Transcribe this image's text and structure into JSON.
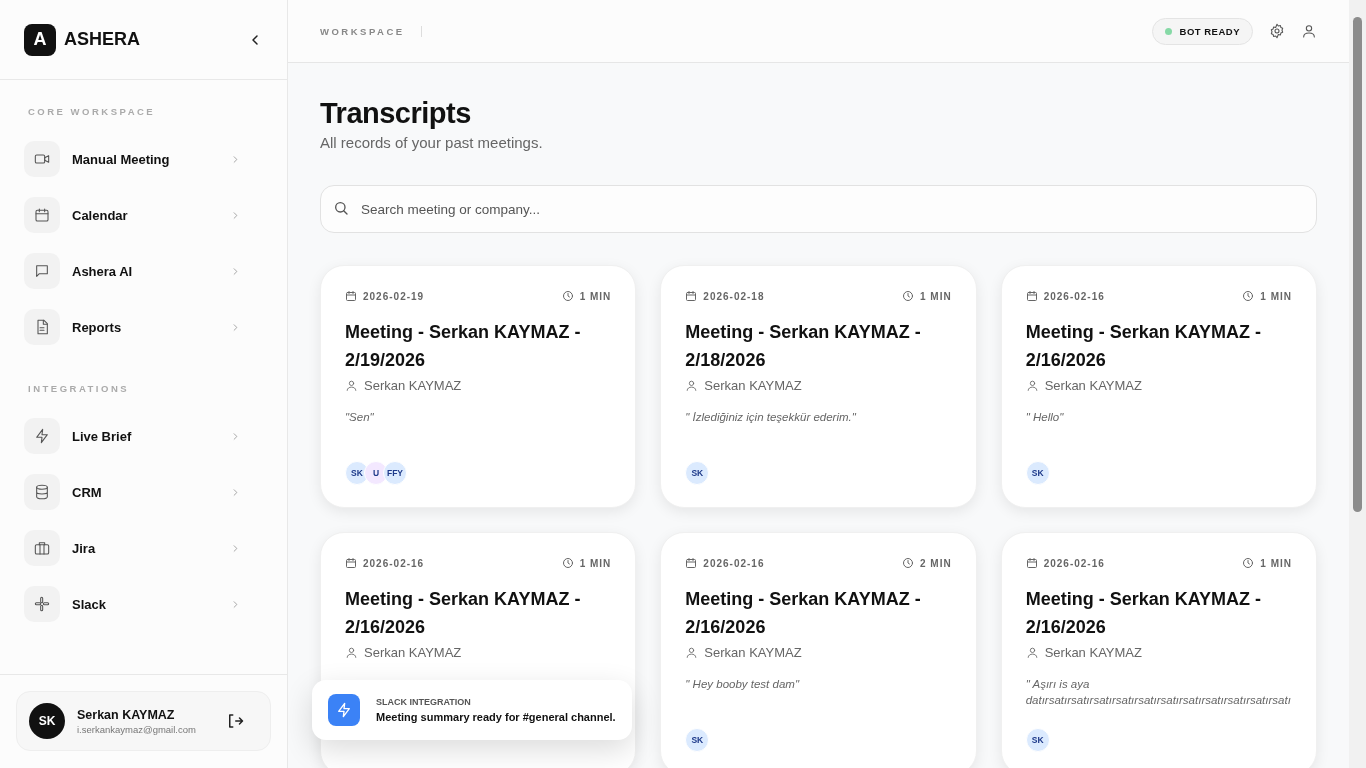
{
  "brand": {
    "logo_letter": "A",
    "name": "ASHERA"
  },
  "sidebar": {
    "sections": [
      {
        "heading": "CORE WORKSPACE",
        "items": [
          {
            "label": "Manual Meeting"
          },
          {
            "label": "Calendar"
          },
          {
            "label": "Ashera AI"
          },
          {
            "label": "Reports"
          }
        ]
      },
      {
        "heading": "INTEGRATIONS",
        "items": [
          {
            "label": "Live Brief"
          },
          {
            "label": "CRM"
          },
          {
            "label": "Jira"
          },
          {
            "label": "Slack"
          }
        ]
      }
    ],
    "user": {
      "initials": "SK",
      "name": "Serkan KAYMAZ",
      "email": "i.serkankaymaz@gmail.com"
    }
  },
  "header": {
    "breadcrumb": "WORKSPACE",
    "status": {
      "label": "BOT READY",
      "color": "#86d9a6"
    }
  },
  "page": {
    "title": "Transcripts",
    "subtitle": "All records of your past meetings.",
    "search": {
      "placeholder": "Search meeting or company..."
    }
  },
  "cards": [
    {
      "date": "2026-02-19",
      "duration": "1 MIN",
      "title": "Meeting - Serkan KAYMAZ - 2/19/2026",
      "owner": "Serkan KAYMAZ",
      "snippet": "\"Sen\"",
      "participants": [
        {
          "initials": "SK",
          "color": "#dbeafe"
        },
        {
          "initials": "U",
          "color": "#f3e8ff"
        },
        {
          "initials": "FFY",
          "color": "#dbeafe"
        }
      ]
    },
    {
      "date": "2026-02-18",
      "duration": "1 MIN",
      "title": "Meeting - Serkan KAYMAZ - 2/18/2026",
      "owner": "Serkan KAYMAZ",
      "snippet": "\" İzlediğiniz için teşekkür ederim.\"",
      "participants": [
        {
          "initials": "SK",
          "color": "#dbeafe"
        }
      ]
    },
    {
      "date": "2026-02-16",
      "duration": "1 MIN",
      "title": "Meeting - Serkan KAYMAZ - 2/16/2026",
      "owner": "Serkan KAYMAZ",
      "snippet": "\" Hello\"",
      "participants": [
        {
          "initials": "SK",
          "color": "#dbeafe"
        }
      ]
    },
    {
      "date": "2026-02-16",
      "duration": "1 MIN",
      "title": "Meeting - Serkan KAYMAZ - 2/16/2026",
      "owner": "Serkan KAYMAZ"
    },
    {
      "date": "2026-02-16",
      "duration": "2 MIN",
      "title": "Meeting - Serkan KAYMAZ - 2/16/2026",
      "owner": "Serkan KAYMAZ",
      "snippet": "\" Hey booby test dam\"",
      "participants": [
        {
          "initials": "SK",
          "color": "#dbeafe"
        }
      ]
    },
    {
      "date": "2026-02-16",
      "duration": "1 MIN",
      "title": "Meeting - Serkan KAYMAZ - 2/16/2026",
      "owner": "Serkan KAYMAZ",
      "snippet": "\" Aşırı is aya datırsatırsatırsatırsatırsatırsatırsatırsatırsatırsatırsatı",
      "participants": [
        {
          "initials": "SK",
          "color": "#dbeafe"
        }
      ]
    }
  ],
  "toast": {
    "heading": "SLACK INTEGRATION",
    "message": "Meeting summary ready for #general channel."
  }
}
